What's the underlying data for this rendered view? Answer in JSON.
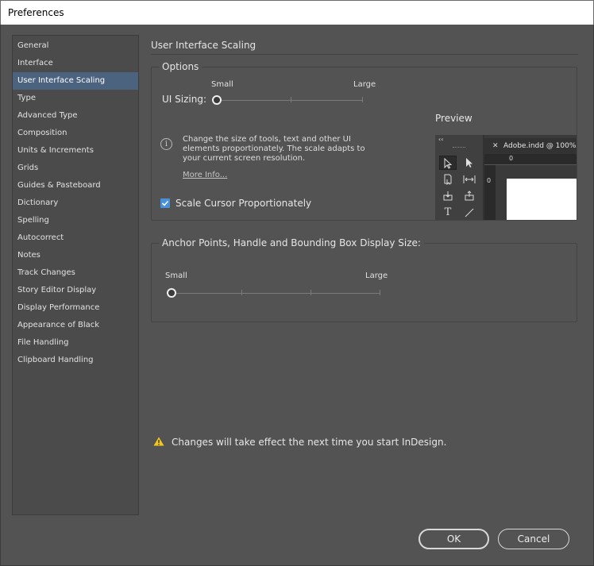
{
  "window": {
    "title": "Preferences"
  },
  "sidebar": {
    "selected_index": 2,
    "items": [
      "General",
      "Interface",
      "User Interface Scaling",
      "Type",
      "Advanced Type",
      "Composition",
      "Units & Increments",
      "Grids",
      "Guides & Pasteboard",
      "Dictionary",
      "Spelling",
      "Autocorrect",
      "Notes",
      "Track Changes",
      "Story Editor Display",
      "Display Performance",
      "Appearance of Black",
      "File Handling",
      "Clipboard Handling"
    ]
  },
  "page": {
    "title": "User Interface Scaling"
  },
  "options": {
    "legend": "Options",
    "ui_sizing_label": "UI Sizing:",
    "small_label": "Small",
    "large_label": "Large",
    "ui_sizing_value_fraction": 0.0,
    "info_text": "Change the size of tools, text and other UI elements proportionately. The scale adapts to your current screen resolution.",
    "more_info": "More Info...",
    "scale_cursor_label": "Scale Cursor Proportionately",
    "scale_cursor_checked": true,
    "preview_label": "Preview",
    "preview_tab": "Adobe.indd @ 100% |",
    "preview_ruler_zero": "0"
  },
  "anchor": {
    "legend": "Anchor Points, Handle and Bounding Box Display Size:",
    "small_label": "Small",
    "large_label": "Large",
    "value_fraction": 0.0
  },
  "warning": {
    "text": "Changes will take effect the next time you start InDesign."
  },
  "buttons": {
    "ok": "OK",
    "cancel": "Cancel"
  },
  "colors": {
    "selected_item": "#4c6380",
    "checkbox": "#4a90d9",
    "warning": "#f5c518"
  }
}
